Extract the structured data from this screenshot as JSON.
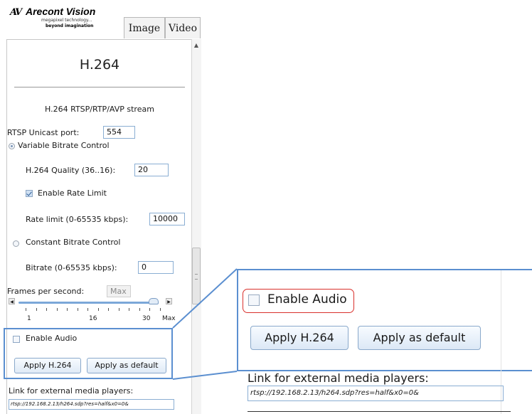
{
  "brand": {
    "logo_mark": "AV",
    "name": "Arecont Vision",
    "tagline_1": "megapixel technology...",
    "tagline_2": "beyond imagination"
  },
  "tabs": [
    {
      "label": "Image"
    },
    {
      "label": "Video"
    }
  ],
  "panel": {
    "section_title": "H.264",
    "stream_label": "H.264 RTSP/RTP/AVP stream",
    "rtsp_port_label": "RTSP Unicast port:",
    "rtsp_port_value": "554",
    "vbr_label": "Variable Bitrate Control",
    "quality_label": "H.264 Quality (36..16):",
    "quality_value": "20",
    "rate_limit_check_label": "Enable Rate Limit",
    "rate_limit_label": "Rate limit (0-65535 kbps):",
    "rate_limit_value": "10000",
    "cbr_label": "Constant Bitrate Control",
    "bitrate_label": "Bitrate (0-65535 kbps):",
    "bitrate_value": "0",
    "fps_label": "Frames per second:",
    "fps_value": "Max",
    "fps_ticks": [
      "1",
      "16",
      "30",
      "Max"
    ],
    "fps_slider_fraction": 0.97,
    "enable_audio_label": "Enable Audio",
    "enable_audio_checked": false,
    "vbr_selected": true,
    "rate_limit_checked": true,
    "apply_button": "Apply H.264",
    "apply_default_button": "Apply as default",
    "link_label": "Link for external media players:",
    "link_value": "rtsp://192.168.2.13/h264.sdp?res=half&x0=0&"
  },
  "zoom": {
    "enable_audio_label": "Enable Audio",
    "apply_button": "Apply H.264",
    "apply_default_button": "Apply as default",
    "link_label": "Link for external media players:",
    "link_value": "rtsp://192.168.2.13/h264.sdp?res=half&x0=0&"
  },
  "colors": {
    "callout_blue": "#5b8fd0",
    "highlight_red": "#d9302c"
  }
}
